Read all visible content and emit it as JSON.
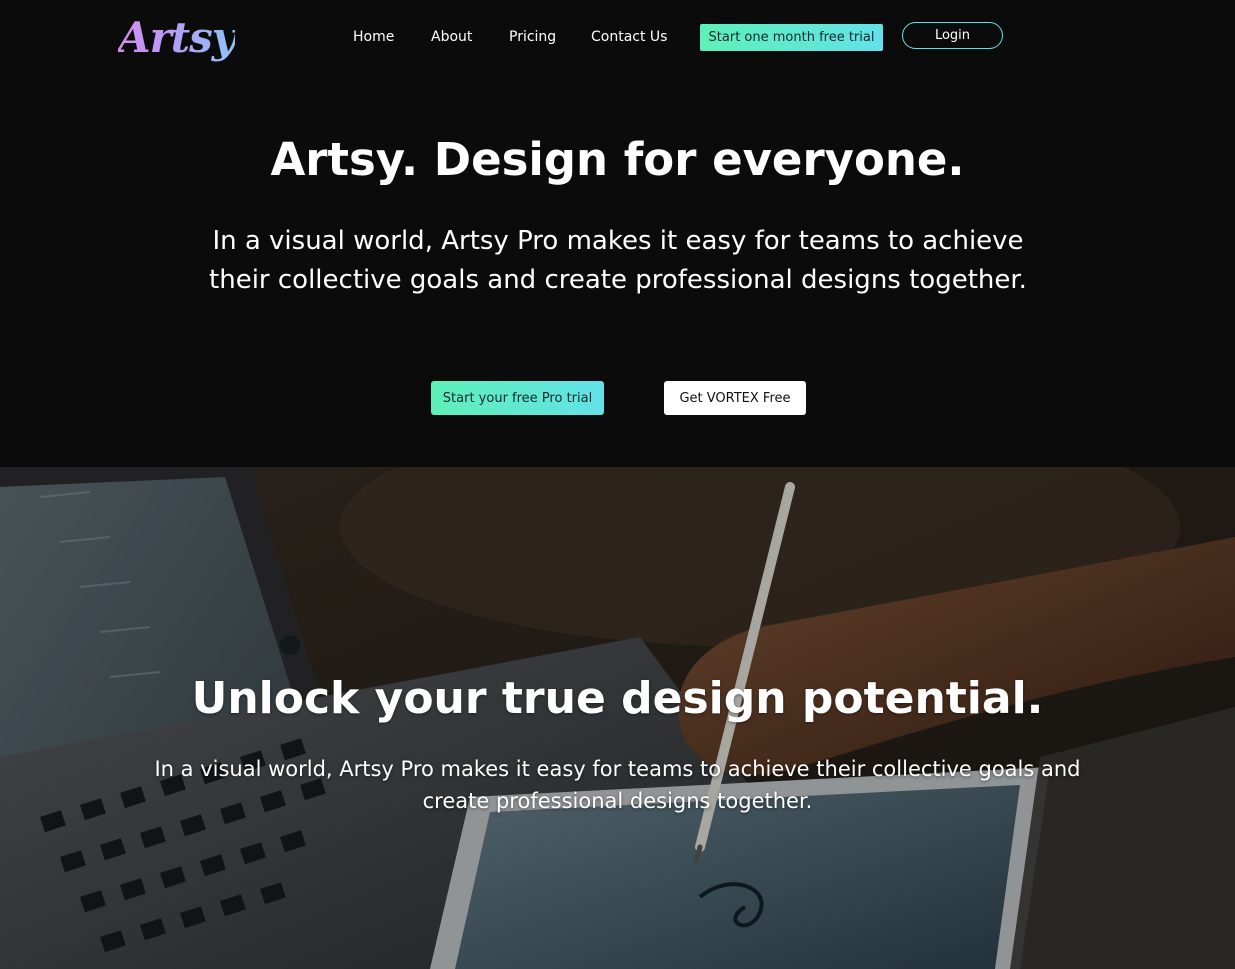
{
  "brand": {
    "logo_text": "Artsy"
  },
  "nav": {
    "items": [
      {
        "label": "Home"
      },
      {
        "label": "About"
      },
      {
        "label": "Pricing"
      },
      {
        "label": "Contact Us"
      }
    ],
    "trial_button": "Start one month free trial",
    "login_button": "Login"
  },
  "hero": {
    "title": "Artsy. Design for everyone.",
    "subtitle": "In a visual world, Artsy Pro makes it easy for teams to achieve their collective goals and create professional designs together.",
    "primary_cta": "Start your free Pro trial",
    "secondary_cta": "Get VORTEX Free"
  },
  "feature": {
    "title": "Unlock your true design potential.",
    "subtitle": "In a visual world, Artsy Pro makes it easy for teams to achieve their collective goals and create professional designs together.",
    "background_image": "laptop-and-tablet-photo"
  },
  "colors": {
    "background": "#0b0b0b",
    "accent_gradient_start": "#5ff0b8",
    "accent_gradient_end": "#63e1e9",
    "login_border": "#5ce4e4",
    "logo_gradient_start": "#d68cf2",
    "logo_gradient_end": "#8ec3f7"
  }
}
